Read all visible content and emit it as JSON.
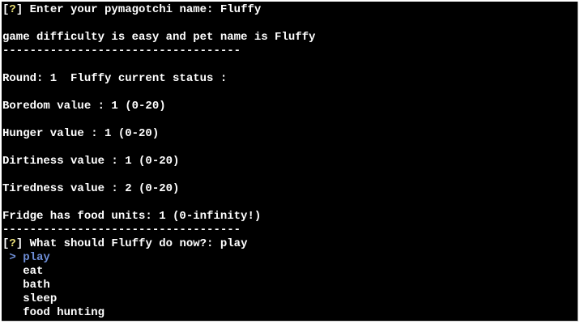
{
  "prompt_name": {
    "open_bracket": "[",
    "mark": "?",
    "close_bracket": "]",
    "text": " Enter your pymagotchi name: Fluffy"
  },
  "summary": "game difficulty is easy and pet name is Fluffy",
  "separator_1": "-----------------------------------",
  "round_line": "Round: 1  Fluffy current status :",
  "stats": {
    "boredom": "Boredom value : 1 (0-20)",
    "hunger": "Hunger value : 1 (0-20)",
    "dirtiness": "Dirtiness value : 1 (0-20)",
    "tiredness": "Tiredness value : 2 (0-20)",
    "fridge": "Fridge has food units: 1 (0-infinity!)"
  },
  "separator_2": "-----------------------------------",
  "prompt_action": {
    "open_bracket": "[",
    "mark": "?",
    "close_bracket": "]",
    "text": " What should Fluffy do now?: play"
  },
  "menu": {
    "pointer": " > ",
    "selected": "play",
    "items": [
      "eat",
      "bath",
      "sleep",
      "food hunting"
    ]
  },
  "colors": {
    "background": "#000000",
    "text": "#ffffff",
    "question_mark": "#e6db74",
    "selected_option": "#6f8fd8"
  }
}
